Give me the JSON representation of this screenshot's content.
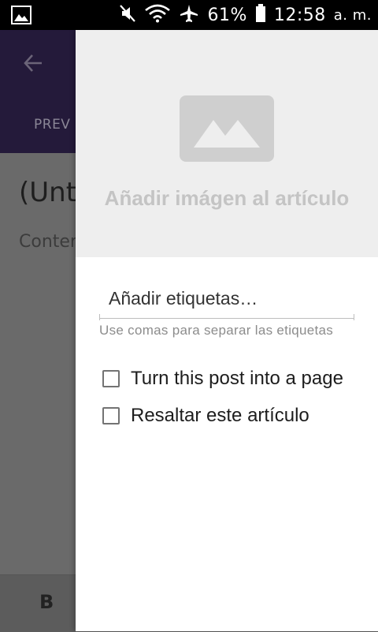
{
  "status_bar": {
    "battery": "61%",
    "time": "12:58",
    "ampm": "a. m.",
    "icons": [
      "gallery-icon",
      "mute-icon",
      "wifi-icon",
      "airplane-icon",
      "battery-icon"
    ]
  },
  "background_screen": {
    "tab_label": "PREV",
    "post_title": "(Unt",
    "content_placeholder": "Conter",
    "format_bold": "B"
  },
  "drawer": {
    "add_image_label": "Añadir imágen al artículo",
    "tags": {
      "placeholder": "Añadir etiquetas…",
      "hint": "Use comas para separar las etiquetas"
    },
    "options": [
      {
        "label": "Turn this post into a page",
        "checked": false
      },
      {
        "label": "Resaltar este artículo",
        "checked": false
      }
    ]
  },
  "colors": {
    "toolbar": "#241a3a",
    "dim_overlay": "#6a6a6a",
    "image_area": "#eeeeee",
    "image_icon": "#cfcfcf"
  }
}
